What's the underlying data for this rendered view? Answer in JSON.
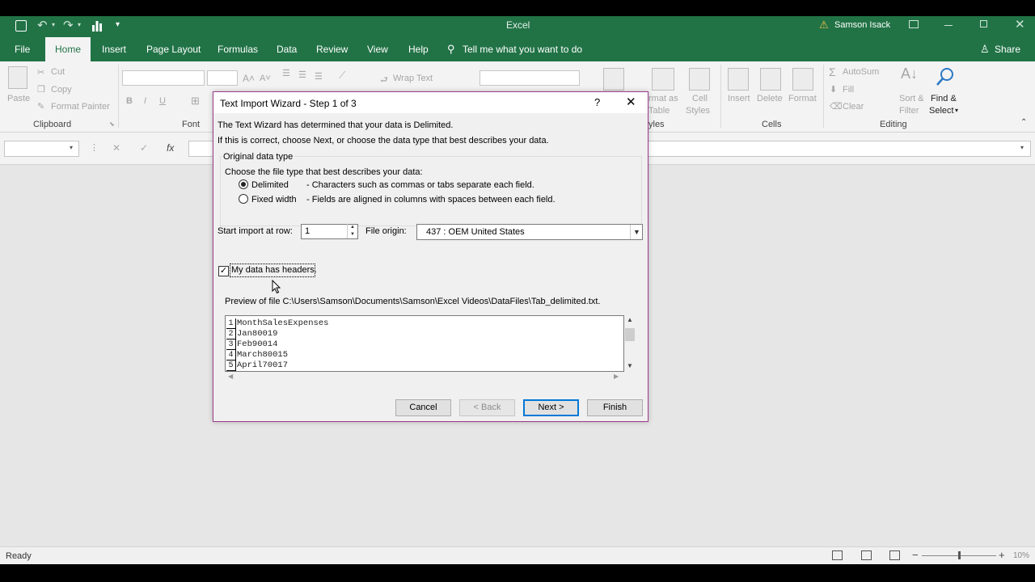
{
  "app": {
    "title": "Excel",
    "user": "Samson Isack",
    "share": "Share"
  },
  "ribbon_tabs": [
    "File",
    "Home",
    "Insert",
    "Page Layout",
    "Formulas",
    "Data",
    "Review",
    "View",
    "Help"
  ],
  "active_tab": "Home",
  "tell_me": "Tell me what you want to do",
  "ribbon": {
    "paste": "Paste",
    "cut": "Cut",
    "copy": "Copy",
    "format_painter": "Format Painter",
    "clipboard": "Clipboard",
    "font": "Font",
    "wrap_text": "Wrap Text",
    "format_as_table_1": "rmat as",
    "format_as_table_2": "Table",
    "cell_styles_1": "Cell",
    "cell_styles_2": "Styles",
    "styles": "yles",
    "insert": "Insert",
    "delete": "Delete",
    "format": "Format",
    "cells": "Cells",
    "autosum": "AutoSum",
    "fill": "Fill",
    "clear": "Clear",
    "sort_filter_1": "Sort &",
    "sort_filter_2": "Filter",
    "find_select_1": "Find &",
    "find_select_2": "Select",
    "editing": "Editing"
  },
  "formula_bar": {
    "fx": "fx"
  },
  "status": {
    "ready": "Ready",
    "zoom": "10%"
  },
  "dialog": {
    "title": "Text Import Wizard - Step 1 of 3",
    "help": "?",
    "intro1": "The Text Wizard has determined that your data is Delimited.",
    "intro2": "If this is correct, choose Next, or choose the data type that best describes your data.",
    "group_title": "Original data type",
    "choose_label": "Choose the file type that best describes your data:",
    "delimited_label": "Delimited",
    "delimited_desc": "- Characters such as commas or tabs separate each field.",
    "fixed_label": "Fixed width",
    "fixed_desc": "- Fields are aligned in columns with spaces between each field.",
    "start_row_label": "Start import at row:",
    "start_row_value": "1",
    "file_origin_label": "File origin:",
    "file_origin_value": "437 : OEM United States",
    "headers_label": "My data has headers.",
    "preview_label": "Preview of file C:\\Users\\Samson\\Documents\\Samson\\Excel Videos\\DataFiles\\Tab_delimited.txt.",
    "preview_rows": [
      {
        "num": "1",
        "text": "MonthSalesExpenses"
      },
      {
        "num": "2",
        "text": "Jan80019"
      },
      {
        "num": "3",
        "text": "Feb90014"
      },
      {
        "num": "4",
        "text": "March80015"
      },
      {
        "num": "5",
        "text": "April70017"
      }
    ],
    "cancel": "Cancel",
    "back": "< Back",
    "next": "Next >",
    "finish": "Finish"
  },
  "colors": {
    "excel_green": "#217346",
    "dialog_border": "#9b3d8b",
    "focus_blue": "#0078d7"
  }
}
